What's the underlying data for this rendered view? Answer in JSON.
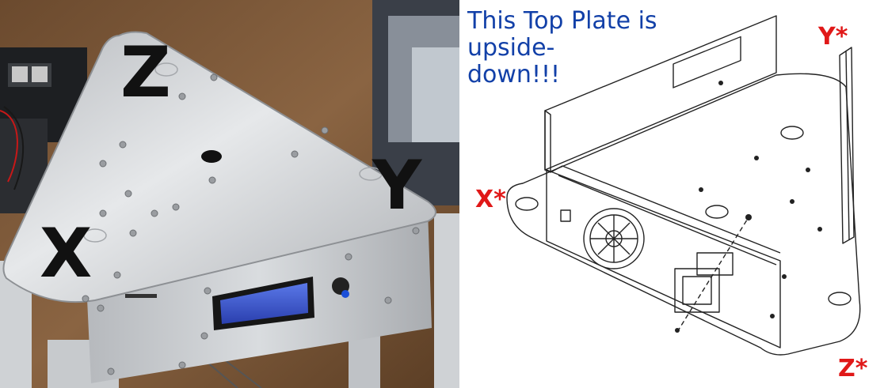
{
  "photo": {
    "labels": {
      "z": "Z",
      "y": "Y",
      "x": "X"
    }
  },
  "diagram": {
    "note": {
      "line1": "This Top Plate is",
      "line2": "upside-",
      "line3": "down!!!"
    },
    "labels": {
      "y": "Y*",
      "x": "X*",
      "z": "Z*"
    }
  },
  "colors": {
    "note": "#1240a8",
    "star_label": "#e01818",
    "plate": "#c9ccd0",
    "lcd": "#3a4fc8"
  }
}
